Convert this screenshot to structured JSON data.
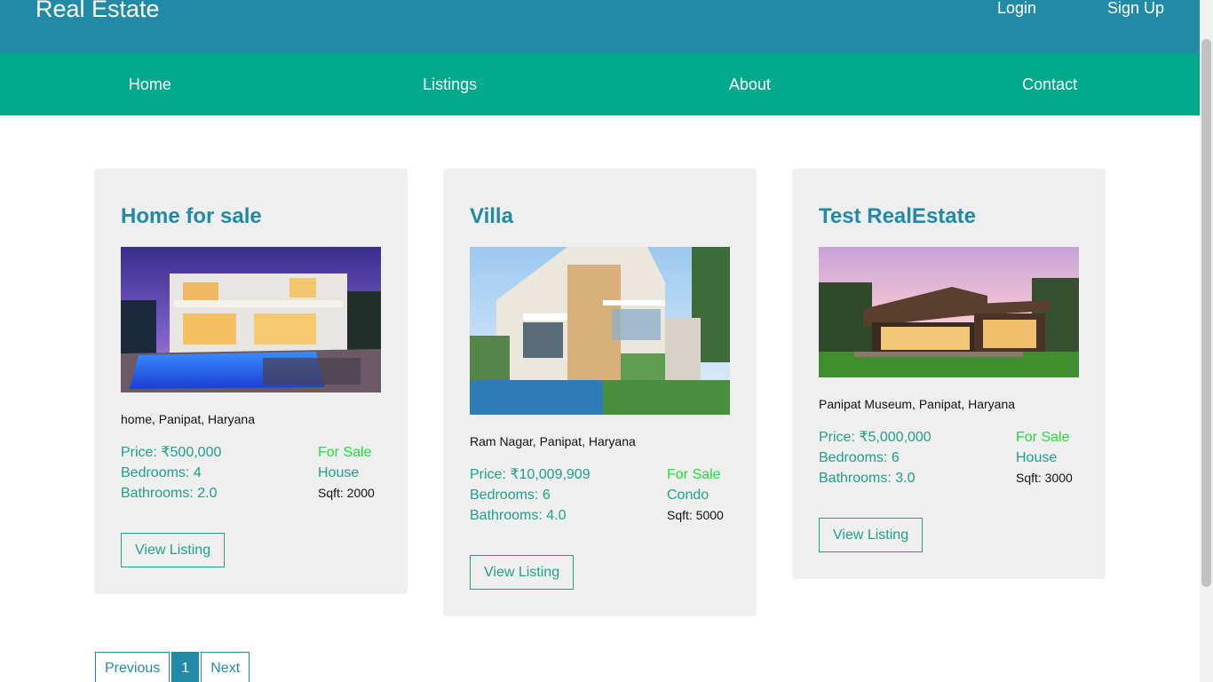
{
  "header": {
    "brand": "Real Estate",
    "login": "Login",
    "signup": "Sign Up"
  },
  "nav": [
    "Home",
    "Listings",
    "About",
    "Contact"
  ],
  "listings": [
    {
      "title": "Home for sale",
      "address": "home, Panipat, Haryana",
      "price": "Price: ₹500,000",
      "bedrooms": "Bedrooms: 4",
      "bathrooms": "Bathrooms: 2.0",
      "status": "For Sale",
      "type": "House",
      "sqft": "Sqft: 2000",
      "button": "View Listing",
      "image": "modern-house-with-pool-at-dusk"
    },
    {
      "title": "Villa",
      "address": "Ram Nagar, Panipat, Haryana",
      "price": "Price: ₹10,009,909",
      "bedrooms": "Bedrooms: 6",
      "bathrooms": "Bathrooms: 4.0",
      "status": "For Sale",
      "type": "Condo",
      "sqft": "Sqft: 5000",
      "button": "View Listing",
      "image": "villa-with-pool-and-palm-trees"
    },
    {
      "title": "Test RealEstate",
      "address": "Panipat Museum, Panipat, Haryana",
      "price": "Price: ₹5,000,000",
      "bedrooms": "Bedrooms: 6",
      "bathrooms": "Bathrooms: 3.0",
      "status": "For Sale",
      "type": "House",
      "sqft": "Sqft: 3000",
      "button": "View Listing",
      "image": "glass-house-on-lawn"
    }
  ],
  "pagination": {
    "previous": "Previous",
    "current": "1",
    "next": "Next"
  },
  "colors": {
    "header": "#218aa6",
    "nav": "#00a98b",
    "accent_text": "#1ea187",
    "status": "#22dd3c"
  }
}
